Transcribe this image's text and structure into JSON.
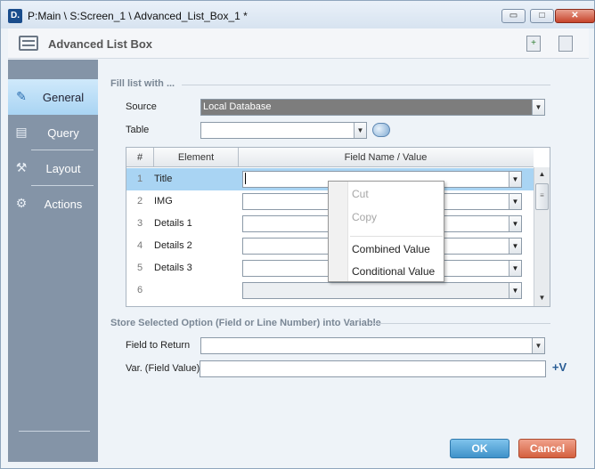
{
  "window": {
    "title": "P:Main \\ S:Screen_1 \\ Advanced_List_Box_1 *",
    "app_icon_text": "D.",
    "buttons": {
      "minimize": "▭",
      "maximize": "□",
      "close": "✕"
    }
  },
  "header": {
    "title": "Advanced List Box"
  },
  "sidebar": {
    "items": [
      {
        "label": "General",
        "icon": "edit-icon",
        "active": true
      },
      {
        "label": "Query",
        "icon": "query-icon",
        "active": false
      },
      {
        "label": "Layout",
        "icon": "layout-icon",
        "active": false
      },
      {
        "label": "Actions",
        "icon": "actions-icon",
        "active": false
      }
    ]
  },
  "fill_section": {
    "title": "Fill list with ...",
    "source_label": "Source",
    "source_value": "Local Database",
    "table_label": "Table",
    "table_value": ""
  },
  "grid": {
    "headers": {
      "num": "#",
      "element": "Element",
      "field": "Field Name / Value"
    },
    "rows": [
      {
        "num": "1",
        "element": "Title",
        "selected": true
      },
      {
        "num": "2",
        "element": "IMG"
      },
      {
        "num": "3",
        "element": "Details 1"
      },
      {
        "num": "4",
        "element": "Details 2"
      },
      {
        "num": "5",
        "element": "Details 3"
      },
      {
        "num": "6",
        "element": ""
      }
    ]
  },
  "context_menu": {
    "items": [
      {
        "label": "Cut",
        "enabled": false
      },
      {
        "label": "Copy",
        "enabled": false
      },
      {
        "label": "Combined Value",
        "enabled": true
      },
      {
        "label": "Conditional Value",
        "enabled": true
      }
    ]
  },
  "store_section": {
    "title": "Store Selected Option (Field or Line Number) into Variable",
    "field_label": "Field to Return",
    "field_value": "",
    "var_label": "Var. (Field Value)",
    "var_value": "",
    "var_button": "+V"
  },
  "footer": {
    "ok_label": "OK",
    "cancel_label": "Cancel"
  },
  "colors": {
    "sidebar": "#8494a7",
    "active_nav": "#a9d4f3",
    "ok": "#3f92c9",
    "cancel": "#d4603f"
  }
}
